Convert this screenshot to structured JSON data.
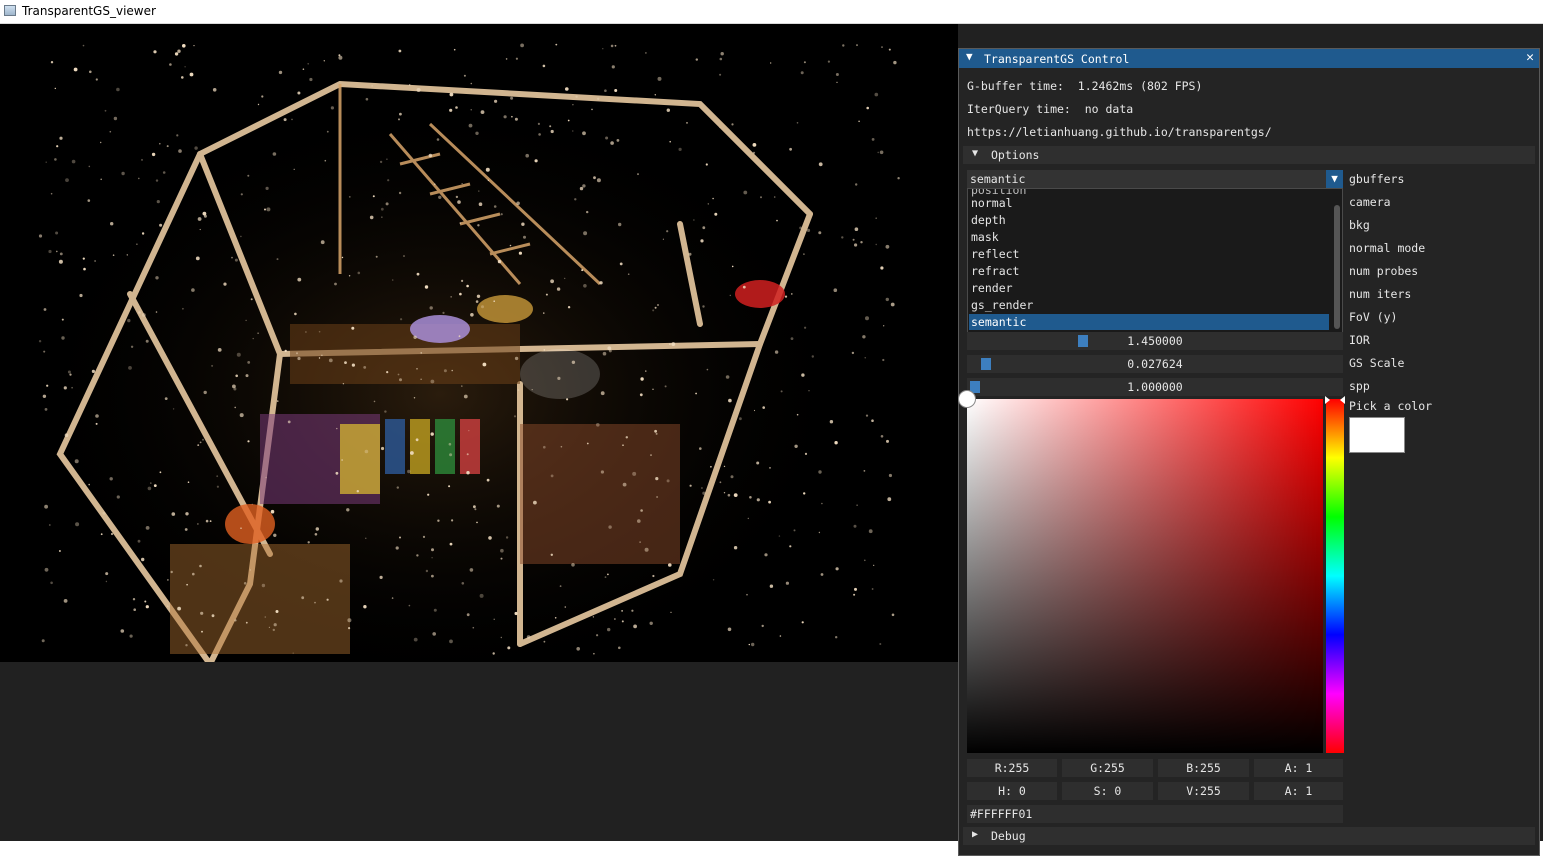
{
  "window": {
    "title": "TransparentGS_viewer"
  },
  "panel": {
    "title": "TransparentGS Control",
    "gbuffer_line": "G-buffer time:  1.2462ms (802 FPS)",
    "iterquery_line": "IterQuery time:  no data",
    "url": "https://letianhuang.github.io/transparentgs/",
    "options_label": "Options",
    "debug_label": "Debug",
    "gbuffer_select": {
      "selected": "semantic",
      "label": "gbuffers",
      "items": [
        "normal",
        "depth",
        "mask",
        "reflect",
        "refract",
        "render",
        "gs_render",
        "semantic"
      ]
    },
    "labels": {
      "camera": "camera",
      "bkg": "bkg",
      "normal_mode": "normal mode",
      "num_probes": "num probes",
      "num_iters": "num iters",
      "fov": "FoV (y)",
      "ior": "IOR",
      "gs_scale": "GS Scale",
      "spp": "spp",
      "pick_color": "Pick a color"
    },
    "sliders": {
      "ior": {
        "value": "1.450000",
        "fraction": 0.3
      },
      "gs_scale": {
        "value": "0.027624",
        "fraction": 0.03
      },
      "spp": {
        "value": "1.000000",
        "fraction": 0.0
      }
    },
    "color": {
      "rgba_fields": [
        "R:255",
        "G:255",
        "B:255",
        "A:  1"
      ],
      "hsva_fields": [
        "H:  0",
        "S:  0",
        "V:255",
        "A:  1"
      ],
      "hex": "#FFFFFF01",
      "value": "#ffffff"
    }
  }
}
